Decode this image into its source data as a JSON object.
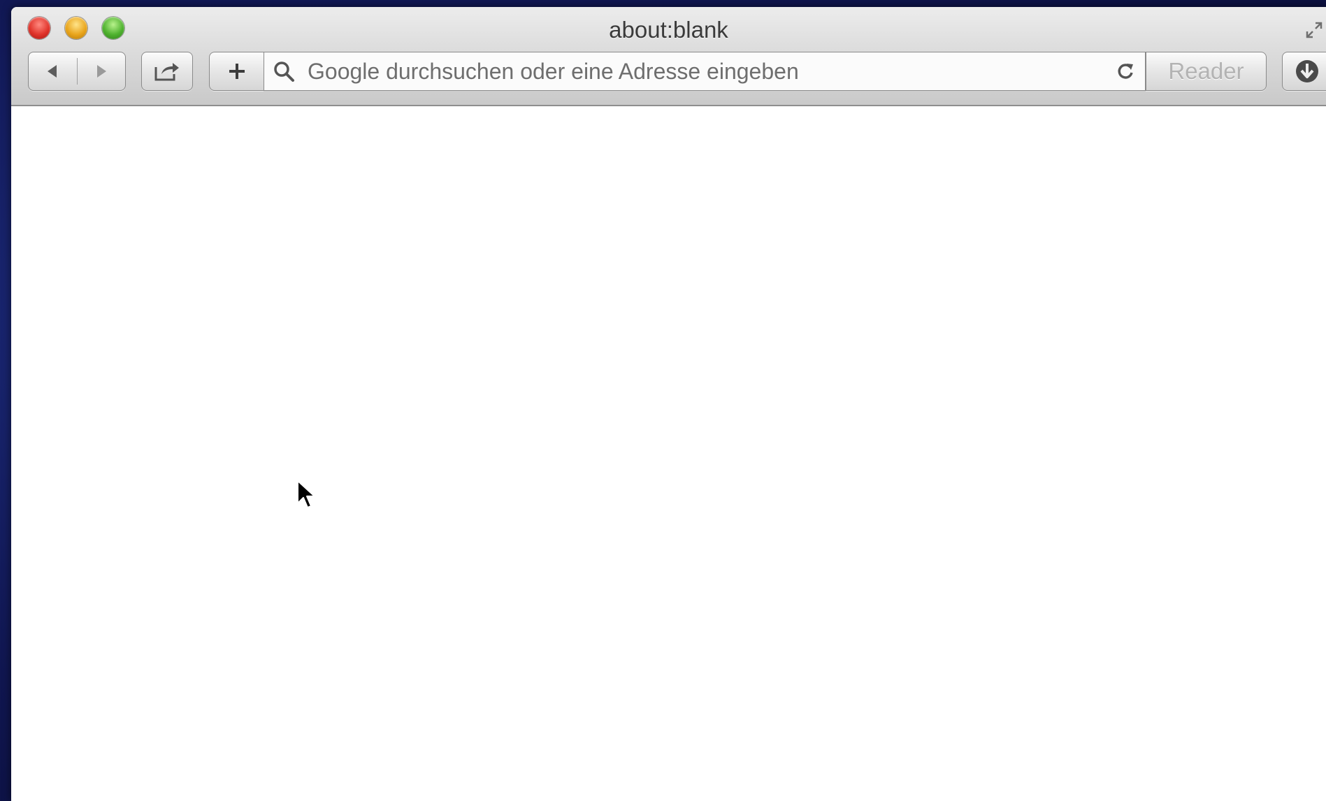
{
  "window": {
    "title": "about:blank"
  },
  "toolbar": {
    "back_icon": "back-arrow-icon",
    "forward_icon": "forward-arrow-icon",
    "share_icon": "share-icon",
    "add_icon": "plus-icon",
    "reader_label": "Reader",
    "download_icon": "download-icon"
  },
  "address_bar": {
    "placeholder": "Google durchsuchen oder eine Adresse eingeben",
    "value": "",
    "search_icon": "search-icon",
    "reload_icon": "reload-icon"
  },
  "traffic_lights": {
    "close_color": "#e0342b",
    "minimize_color": "#e9a51c",
    "zoom_color": "#4fb22f"
  }
}
